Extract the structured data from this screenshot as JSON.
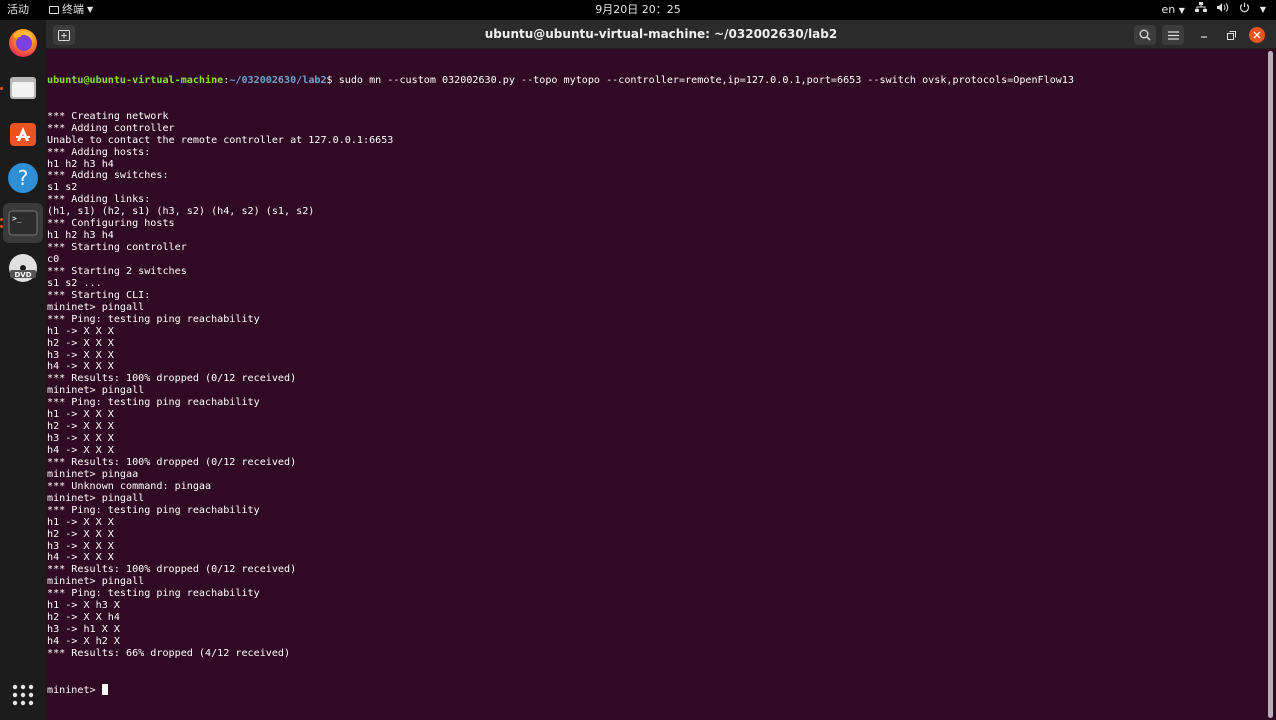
{
  "topbar": {
    "activities": "活动",
    "app_name": "终端",
    "clock": "9月20日 20：25",
    "language": "en"
  },
  "dock": {
    "items": [
      {
        "name": "firefox-icon",
        "running": false
      },
      {
        "name": "files-icon",
        "running": true
      },
      {
        "name": "app-store-icon",
        "running": false
      },
      {
        "name": "help-icon",
        "running": false
      },
      {
        "name": "terminal-icon",
        "running": true,
        "active": true
      },
      {
        "name": "dvd-icon",
        "running": false
      }
    ],
    "apps_grid": "show-applications-icon"
  },
  "window": {
    "title": "ubuntu@ubuntu-virtual-machine: ~/032002630/lab2"
  },
  "terminal": {
    "prompt_user": "ubuntu@ubuntu-virtual-machine",
    "prompt_path": "~/032002630/lab2",
    "command": "$ sudo mn --custom 032002630.py --topo mytopo --controller=remote,ip=127.0.0.1,port=6653 --switch ovsk,protocols=OpenFlow13",
    "lines": [
      "*** Creating network",
      "*** Adding controller",
      "Unable to contact the remote controller at 127.0.0.1:6653",
      "*** Adding hosts:",
      "h1 h2 h3 h4",
      "*** Adding switches:",
      "s1 s2",
      "*** Adding links:",
      "(h1, s1) (h2, s1) (h3, s2) (h4, s2) (s1, s2)",
      "*** Configuring hosts",
      "h1 h2 h3 h4",
      "*** Starting controller",
      "c0",
      "*** Starting 2 switches",
      "s1 s2 ...",
      "*** Starting CLI:",
      "mininet> pingall",
      "*** Ping: testing ping reachability",
      "h1 -> X X X",
      "h2 -> X X X",
      "h3 -> X X X",
      "h4 -> X X X",
      "*** Results: 100% dropped (0/12 received)",
      "mininet> pingall",
      "*** Ping: testing ping reachability",
      "h1 -> X X X",
      "h2 -> X X X",
      "h3 -> X X X",
      "h4 -> X X X",
      "*** Results: 100% dropped (0/12 received)",
      "mininet> pingaa",
      "*** Unknown command: pingaa",
      "mininet> pingall",
      "*** Ping: testing ping reachability",
      "h1 -> X X X",
      "h2 -> X X X",
      "h3 -> X X X",
      "h4 -> X X X",
      "*** Results: 100% dropped (0/12 received)",
      "mininet> pingall",
      "*** Ping: testing ping reachability",
      "h1 -> X h3 X",
      "h2 -> X X h4",
      "h3 -> h1 X X",
      "h4 -> X h2 X",
      "*** Results: 66% dropped (4/12 received)"
    ],
    "final_prompt": "mininet> "
  },
  "colors": {
    "terminal_bg": "#300a24",
    "prompt_user": "#8ae234",
    "prompt_path": "#729fcf",
    "accent": "#e95420"
  }
}
